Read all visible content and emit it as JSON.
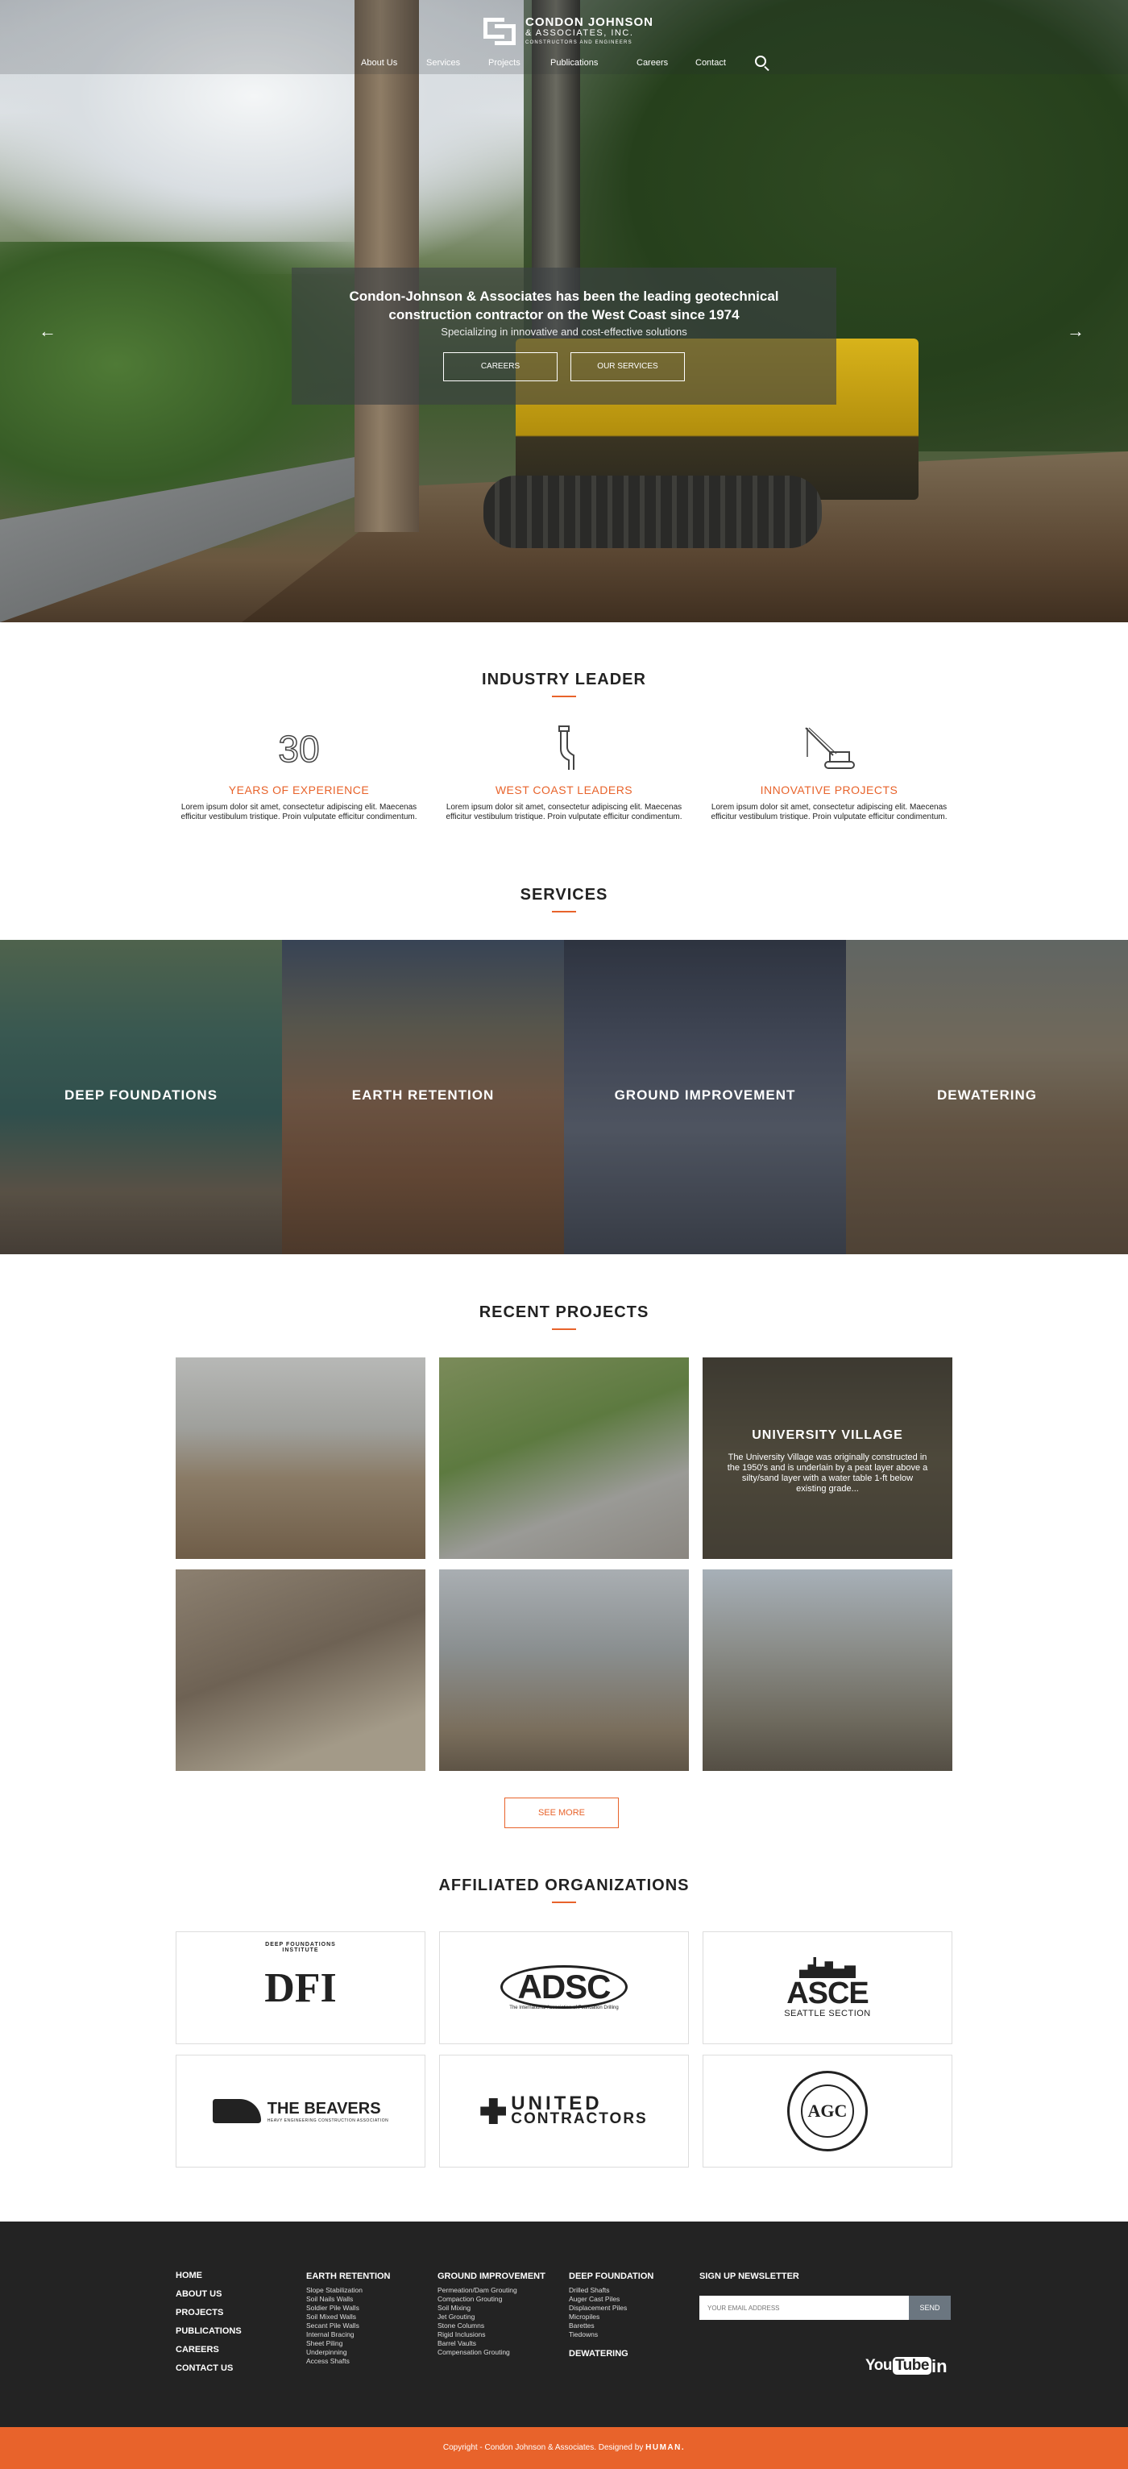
{
  "brand": {
    "line1": "CONDON JOHNSON",
    "line2": "& ASSOCIATES, INC.",
    "line3": "CONSTRUCTORS AND ENGINEERS"
  },
  "nav": {
    "items": [
      "About Us",
      "Services",
      "Projects",
      "Publications",
      "Careers",
      "Contact"
    ],
    "search_icon": "search-icon"
  },
  "hero": {
    "headline": "Condon-Johnson & Associates has been the leading geotechnical construction contractor on the West Coast since 1974",
    "subheadline": "Specializing in innovative and cost-effective solutions",
    "buttons": [
      "CAREERS",
      "OUR SERVICES"
    ],
    "prev_icon": "arrow-left-icon",
    "next_icon": "arrow-right-icon"
  },
  "industry": {
    "title": "INDUSTRY LEADER",
    "features": [
      {
        "icon": "30",
        "title": "YEARS OF EXPERIENCE",
        "text": "Lorem ipsum dolor sit amet, consectetur adipiscing elit. Maecenas efficitur vestibulum tristique. Proin vulputate efficitur condimentum."
      },
      {
        "icon": "pipe-icon",
        "title": "WEST COAST LEADERS",
        "text": "Lorem ipsum dolor sit amet, consectetur adipiscing elit. Maecenas efficitur vestibulum tristique. Proin vulputate efficitur condimentum."
      },
      {
        "icon": "crane-icon",
        "title": "INNOVATIVE PROJECTS",
        "text": "Lorem ipsum dolor sit amet, consectetur adipiscing elit. Maecenas efficitur vestibulum tristique. Proin vulputate efficitur condimentum."
      }
    ]
  },
  "services": {
    "title": "SERVICES",
    "tiles": [
      "DEEP FOUNDATIONS",
      "EARTH RETENTION",
      "GROUND IMPROVEMENT",
      "DEWATERING"
    ]
  },
  "projects": {
    "title": "RECENT PROJECTS",
    "featured_title": "UNIVERSITY VILLAGE",
    "featured_desc": "The University Village was originally constructed in the 1950's and is underlain by a peat layer above a silty/sand layer with a water table 1-ft below existing grade...",
    "see_more": "SEE MORE"
  },
  "affiliated": {
    "title": "AFFILIATED ORGANIZATIONS",
    "dfi": {
      "arc": "DEEP FOUNDATIONS INSTITUTE",
      "core": "DFI"
    },
    "adsc": {
      "main": "ADSC",
      "sub": "The International Association of Foundation Drilling"
    },
    "asce": {
      "main": "ASCE",
      "sub": "SEATTLE SECTION"
    },
    "beavers": {
      "main": "THE BEAVERS",
      "sub": "HEAVY ENGINEERING CONSTRUCTION ASSOCIATION"
    },
    "united": {
      "line1": "UNITED",
      "line2": "CONTRACTORS"
    },
    "agc": {
      "core": "AGC"
    }
  },
  "footer": {
    "main_links": [
      "HOME",
      "ABOUT US",
      "PROJECTS",
      "PUBLICATIONS",
      "CAREERS",
      "CONTACT US"
    ],
    "earth_retention": {
      "title": "EARTH RETENTION",
      "items": [
        "Slope Stabilization",
        "Soil Nails Walls",
        "Soldier Pile Walls",
        "Soil Mixed Walls",
        "Secant Pile Walls",
        "Internal Bracing",
        "Sheet Piling",
        "Underpinning",
        "Access Shafts"
      ]
    },
    "ground_improvement": {
      "title": "GROUND IMPROVEMENT",
      "items": [
        "Permeation/Dam Grouting",
        "Compaction Grouting",
        "Soil Mixing",
        "Jet Grouting",
        "Stone Columns",
        "Rigid Inclusions",
        "Barrel Vaults",
        "Compensation Grouting"
      ]
    },
    "deep_foundation": {
      "title": "DEEP FOUNDATION",
      "items": [
        "Drilled Shafts",
        "Auger Cast Piles",
        "Displacement Piles",
        "Micropiles",
        "Barettes",
        "Tiedowns"
      ]
    },
    "dewatering": "DEWATERING",
    "newsletter": {
      "title": "SIGN UP NEWSLETTER",
      "placeholder": "YOUR EMAIL ADDRESS",
      "button": "SEND"
    },
    "social": {
      "youtube_a": "You",
      "youtube_b": "Tube",
      "linkedin": "in"
    }
  },
  "copyright": {
    "text": "Copyright - Condon Johnson & Associates. Designed by",
    "designer": "HUMAN."
  },
  "colors": {
    "accent": "#e8632b",
    "footer_bg": "#232323"
  }
}
